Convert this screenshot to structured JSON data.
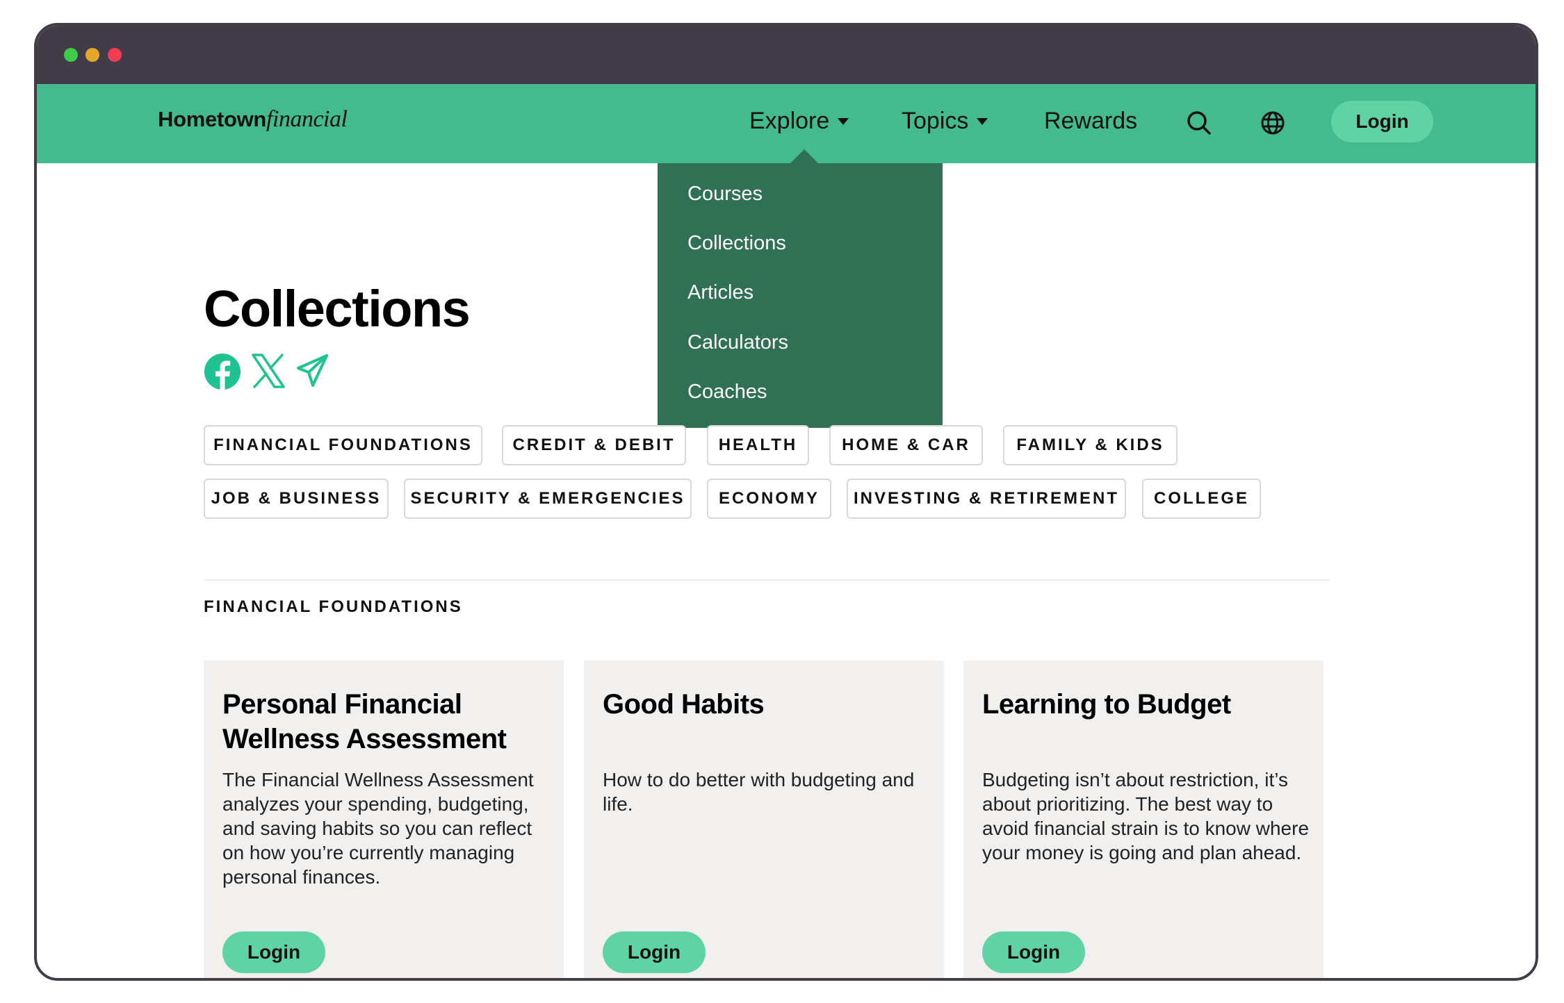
{
  "brand": {
    "name_bold": "Hometown",
    "name_script": "financial"
  },
  "nav": {
    "items": [
      {
        "label": "Explore",
        "has_caret": true
      },
      {
        "label": "Topics",
        "has_caret": true
      },
      {
        "label": "Rewards",
        "has_caret": false
      }
    ],
    "icons": [
      "search-icon",
      "globe-icon"
    ],
    "login_label": "Login"
  },
  "dropdown": {
    "open_for": "Explore",
    "items": [
      "Courses",
      "Collections",
      "Articles",
      "Calculators",
      "Coaches"
    ]
  },
  "page": {
    "title": "Collections",
    "share_icons": [
      "facebook-icon",
      "x-icon",
      "telegram-icon"
    ]
  },
  "topics": {
    "row1": [
      "FINANCIAL FOUNDATIONS",
      "CREDIT & DEBIT",
      "HEALTH",
      "HOME & CAR",
      "FAMILY & KIDS"
    ],
    "row2": [
      "JOB & BUSINESS",
      "SECURITY & EMERGENCIES",
      "ECONOMY",
      "INVESTING & RETIREMENT",
      "COLLEGE"
    ]
  },
  "section": {
    "label": "FINANCIAL FOUNDATIONS",
    "cards": [
      {
        "title": "Personal Financial Wellness Assessment",
        "description": "The Financial Wellness Assessment analyzes your spending, budgeting, and saving habits so you can reflect on how you’re currently managing personal finances.",
        "button": "Login"
      },
      {
        "title": "Good Habits",
        "description": "How to do better with budgeting and life.",
        "button": "Login"
      },
      {
        "title": "Learning to Budget",
        "description": "Budgeting isn’t about restriction, it’s about prioritizing. The best way to avoid financial strain is to know where your money is going and plan ahead.",
        "button": "Login"
      }
    ]
  },
  "colors": {
    "nav_green": "#43bb8f",
    "dropdown_green": "#307156",
    "button_green": "#5fd3a3",
    "accent_icon": "#1fc391",
    "window_chrome": "#413c48",
    "card_bg": "#f1f0ee"
  }
}
